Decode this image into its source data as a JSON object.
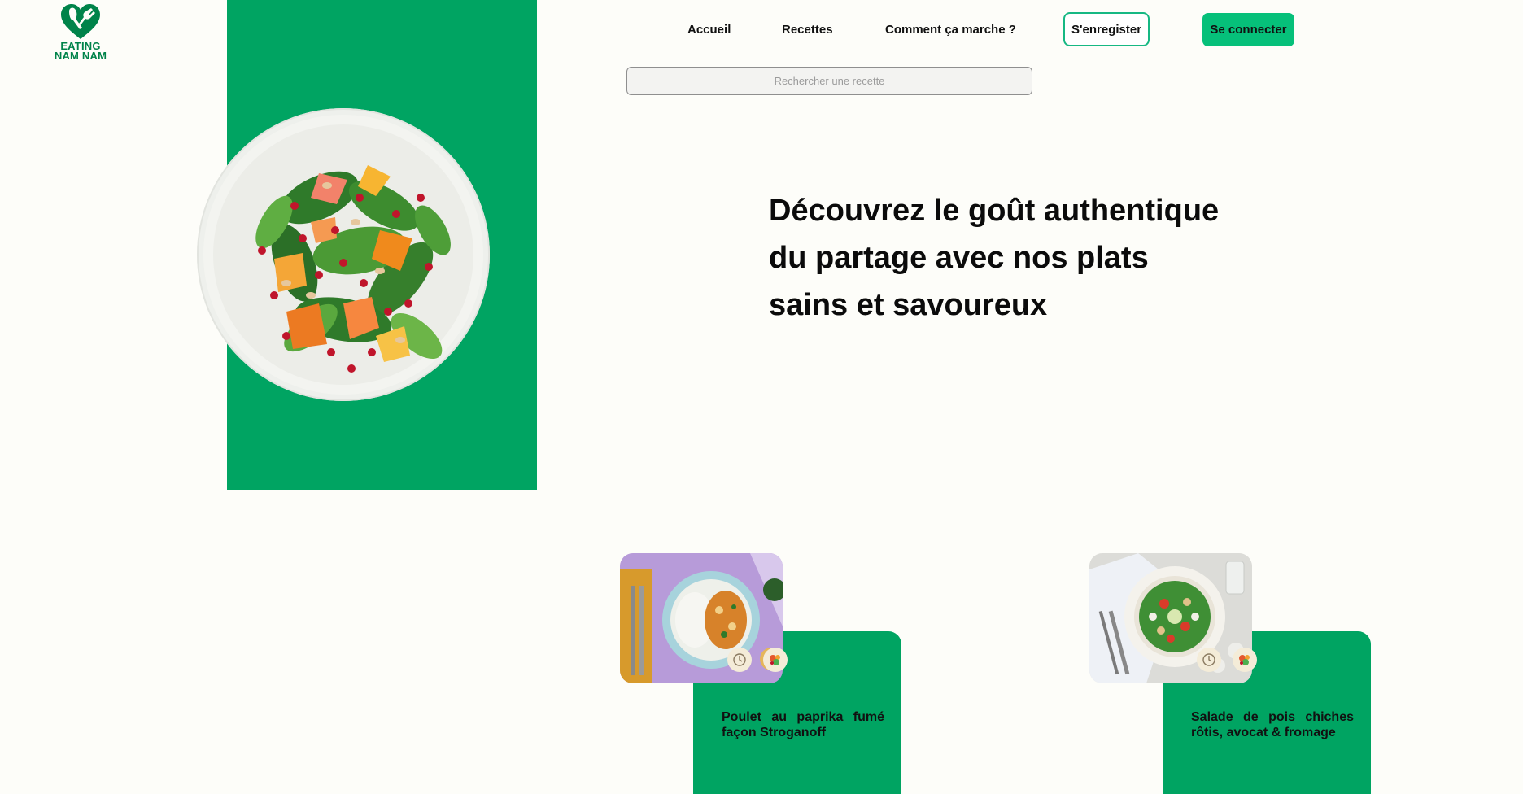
{
  "brand": {
    "logo_line1": "EATING",
    "logo_line2": "NAM NAM",
    "color": "#00834a"
  },
  "nav": {
    "links": [
      "Accueil",
      "Recettes",
      "Comment ça marche ?"
    ],
    "register_label": "S'enregister",
    "login_label": "Se connecter"
  },
  "search": {
    "placeholder": "Rechercher une recette",
    "value": ""
  },
  "hero": {
    "title_lines": [
      "Découvrez le goût authentique",
      "du partage avec nos plats",
      "sains et savoureux"
    ],
    "panel_color": "#00a462"
  },
  "recipes": [
    {
      "title": "Poulet au paprika fumé façon Stroganoff",
      "icons": [
        "timer-icon",
        "ingredients-icon"
      ]
    },
    {
      "title": "Salade de pois chiches rôtis, avocat & fromage",
      "icons": [
        "timer-icon",
        "ingredients-icon"
      ]
    }
  ],
  "colors": {
    "accent": "#06c07a",
    "accent_border": "#16b883",
    "background": "#fdfdf9"
  }
}
